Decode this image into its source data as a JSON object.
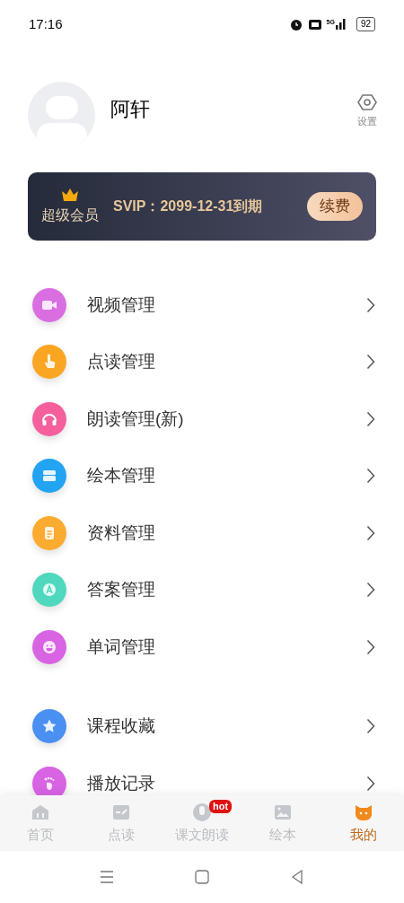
{
  "status_bar": {
    "time": "17:16",
    "network": "5G",
    "battery": "92"
  },
  "profile": {
    "name": "阿轩",
    "settings_label": "设置"
  },
  "vip": {
    "label": "超级会员",
    "expiry": "SVIP：2099-12-31到期",
    "renew": "续费"
  },
  "menu_groups": [
    [
      {
        "label": "视频管理",
        "color": "#d96ee0"
      },
      {
        "label": "点读管理",
        "color": "#fba623"
      },
      {
        "label": "朗读管理(新)",
        "color": "#f45f9c"
      },
      {
        "label": "绘本管理",
        "color": "#22a4f2"
      },
      {
        "label": "资料管理",
        "color": "#fbab2f"
      },
      {
        "label": "答案管理",
        "color": "#4fd8bd"
      },
      {
        "label": "单词管理",
        "color": "#d863e3"
      }
    ],
    [
      {
        "label": "课程收藏",
        "color": "#4a8ff2"
      },
      {
        "label": "播放记录",
        "color": "#d863e3"
      }
    ]
  ],
  "tab_bar": [
    {
      "label": "首页",
      "selected": false
    },
    {
      "label": "点读",
      "selected": false
    },
    {
      "label": "课文朗读",
      "selected": false,
      "badge": "hot"
    },
    {
      "label": "绘本",
      "selected": false
    },
    {
      "label": "我的",
      "selected": true
    }
  ]
}
